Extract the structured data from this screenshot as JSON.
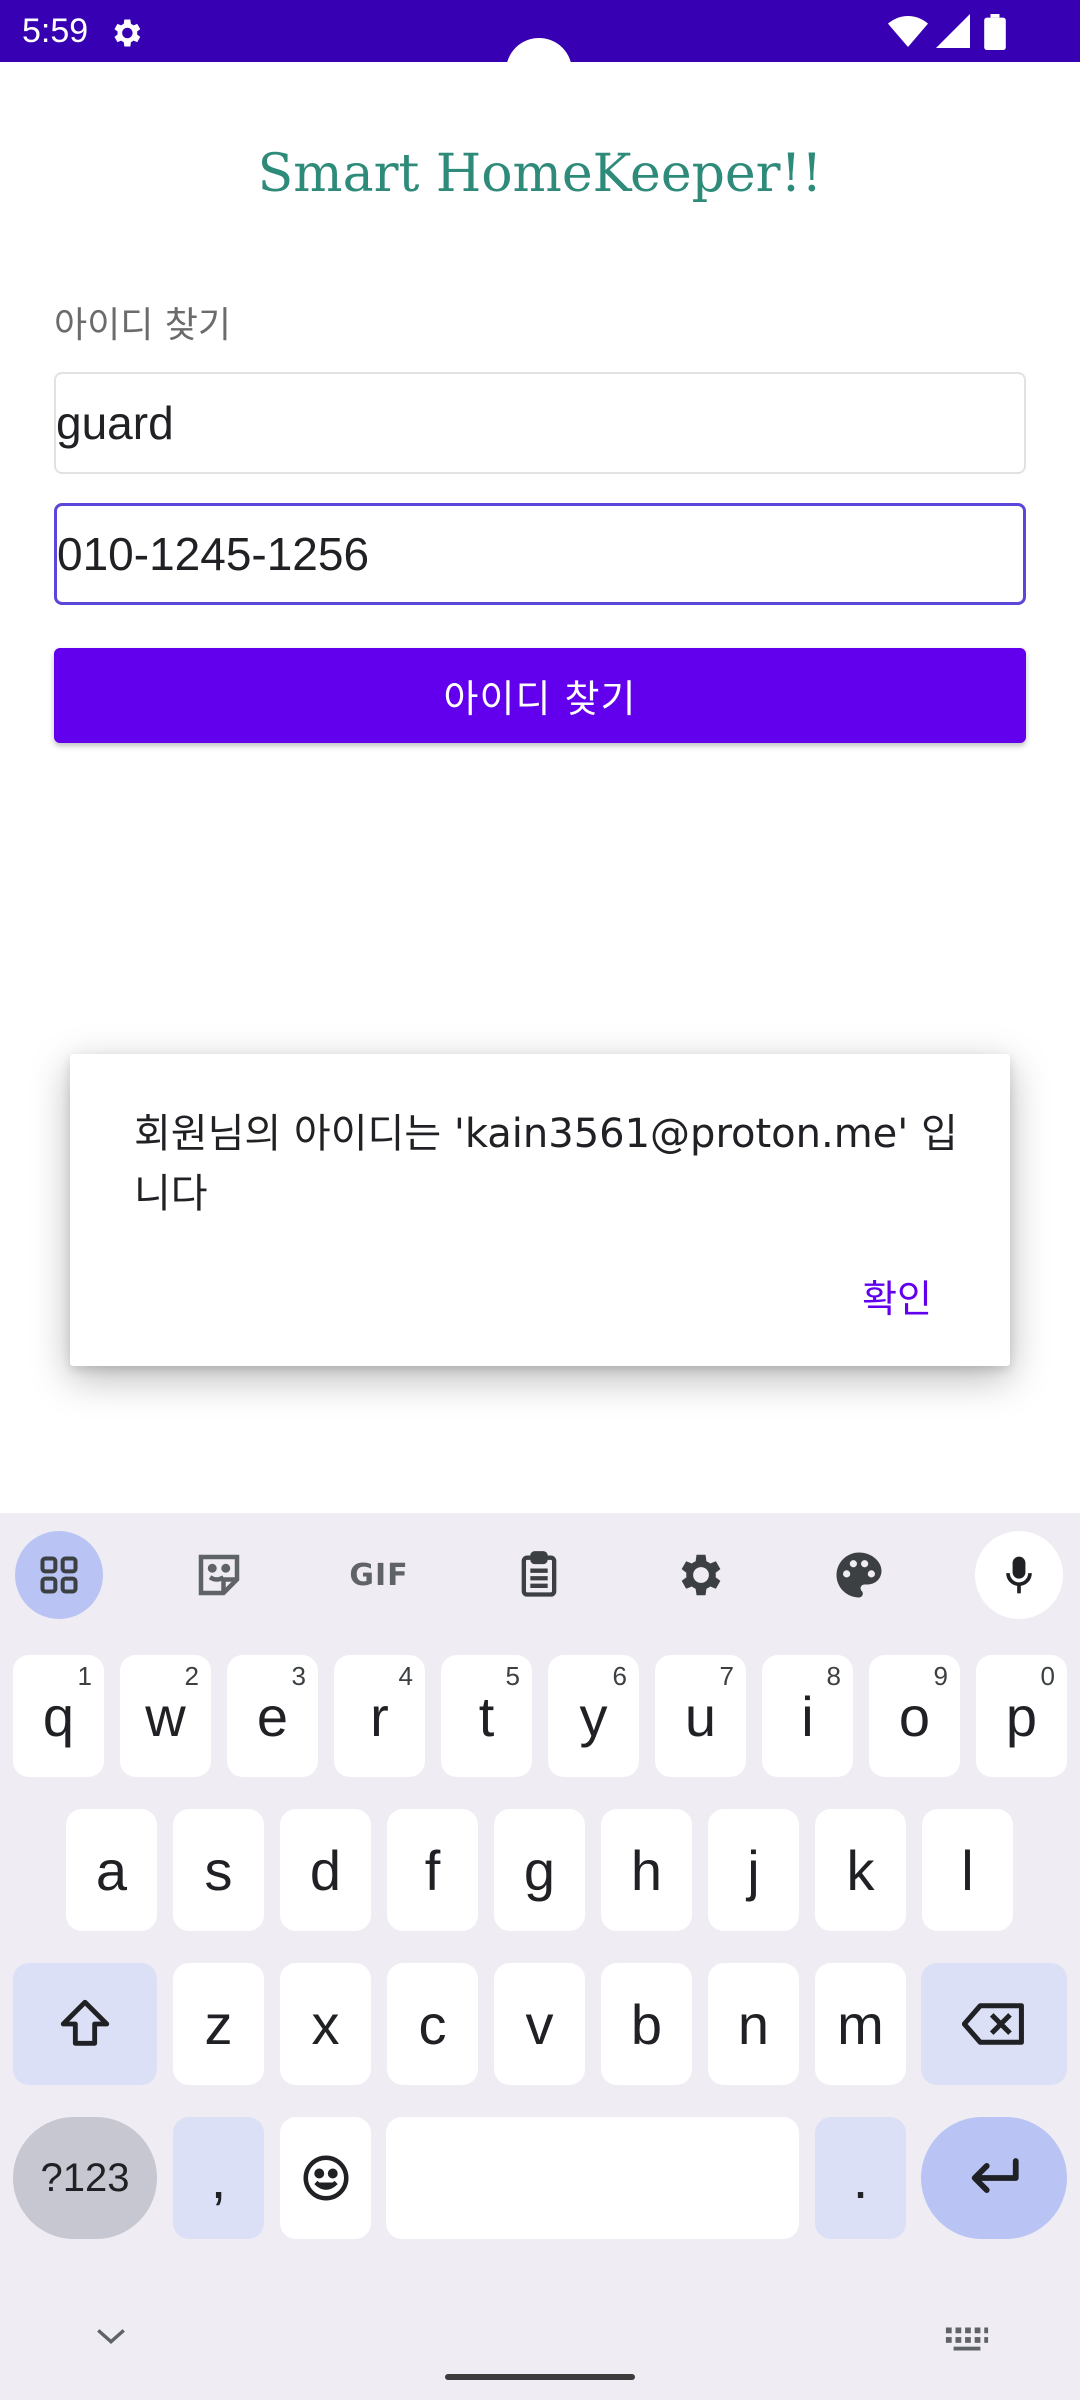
{
  "status_bar": {
    "time": "5:59",
    "icons": [
      "gear-icon",
      "wifi-icon",
      "signal-icon",
      "battery-icon"
    ]
  },
  "app": {
    "title": "Smart HomeKeeper!!",
    "section_label": "아이디 찾기",
    "name_field": {
      "value": "guard"
    },
    "phone_field": {
      "value": "010-1245-1256"
    },
    "find_button_label": "아이디 찾기"
  },
  "dialog": {
    "message": "회원님의 아이디는 'kain3561@proton.me' 입니다",
    "ok_label": "확인"
  },
  "keyboard": {
    "toolbar": {
      "gif_label": "GIF"
    },
    "row1": [
      {
        "key": "q",
        "hint": "1"
      },
      {
        "key": "w",
        "hint": "2"
      },
      {
        "key": "e",
        "hint": "3"
      },
      {
        "key": "r",
        "hint": "4"
      },
      {
        "key": "t",
        "hint": "5"
      },
      {
        "key": "y",
        "hint": "6"
      },
      {
        "key": "u",
        "hint": "7"
      },
      {
        "key": "i",
        "hint": "8"
      },
      {
        "key": "o",
        "hint": "9"
      },
      {
        "key": "p",
        "hint": "0"
      }
    ],
    "row2": [
      "a",
      "s",
      "d",
      "f",
      "g",
      "h",
      "j",
      "k",
      "l"
    ],
    "row3": [
      "z",
      "x",
      "c",
      "v",
      "b",
      "n",
      "m"
    ],
    "symbols_label": "?123",
    "comma_label": ",",
    "period_label": "."
  },
  "colors": {
    "status_bar": "#3700b3",
    "primary": "#6200ee",
    "title": "#2e8b7a",
    "focus_border": "#5a46d9"
  }
}
